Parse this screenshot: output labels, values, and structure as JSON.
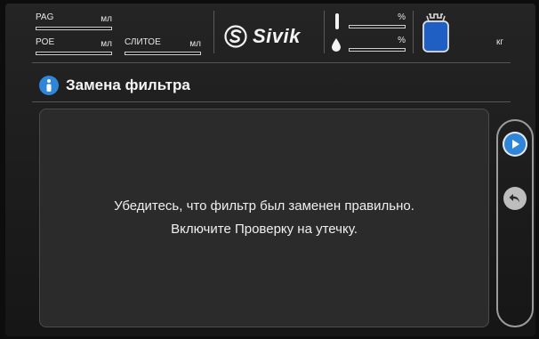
{
  "header": {
    "pag_label": "PAG",
    "pag_unit": "мл",
    "poe_label": "POE",
    "poe_unit": "мл",
    "drain_label": "СЛИТОЕ",
    "drain_unit": "мл",
    "brand": "Sivik",
    "temp_unit": "%",
    "humidity_unit": "%",
    "tank_unit": "кг",
    "tank_color": "#1f5fc4"
  },
  "page": {
    "title": "Замена фильтра",
    "title_icon": "info-icon"
  },
  "message": {
    "line1": "Убедитесь, что фильтр был заменен правильно.",
    "line2": "Включите Проверку на утечку."
  },
  "nav": {
    "next_icon": "play-next-icon",
    "back_icon": "undo-back-icon"
  },
  "colors": {
    "accent": "#2f86d8",
    "background": "#1c1c1c",
    "panel": "#2b2b2b"
  }
}
